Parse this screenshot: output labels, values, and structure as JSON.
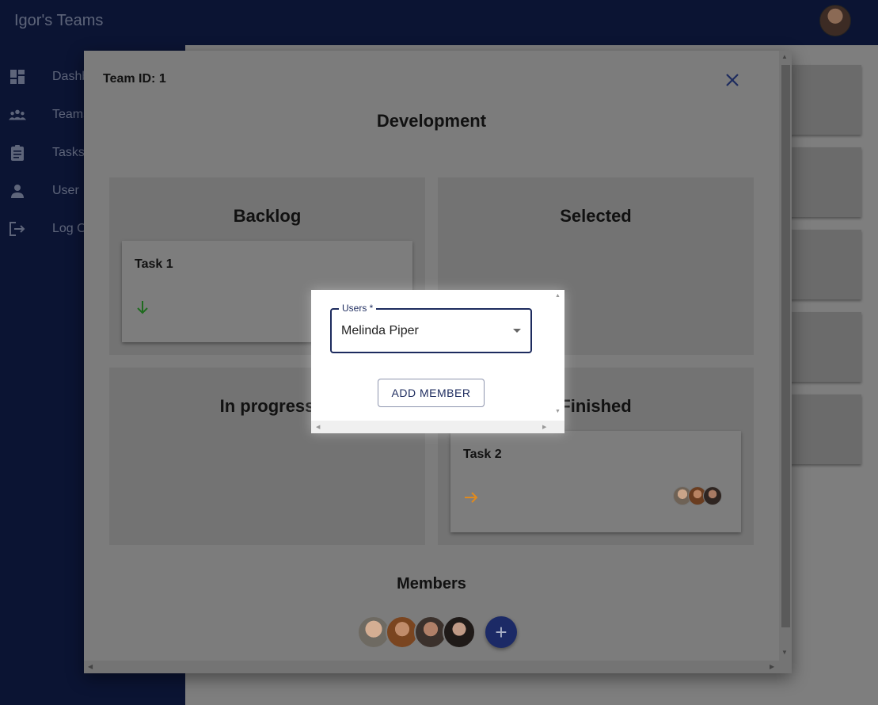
{
  "app": {
    "title": "Igor's Teams"
  },
  "sidebar": {
    "items": [
      {
        "label": "Dashboard",
        "icon": "dashboard-icon"
      },
      {
        "label": "Teams",
        "icon": "people-icon"
      },
      {
        "label": "Tasks",
        "icon": "clipboard-icon"
      },
      {
        "label": "User",
        "icon": "person-icon"
      },
      {
        "label": "Log Out",
        "icon": "logout-icon"
      }
    ]
  },
  "team_modal": {
    "team_id_label": "Team ID: 1",
    "team_name": "Development",
    "columns": [
      {
        "title": "Backlog",
        "tasks": [
          {
            "title": "Task 1",
            "arrow": "down",
            "arrow_color": "#1f6b1f"
          }
        ]
      },
      {
        "title": "Selected",
        "tasks": []
      },
      {
        "title": "In progress",
        "tasks": []
      },
      {
        "title": "Finished",
        "tasks": [
          {
            "title": "Task 2",
            "arrow": "right",
            "arrow_color": "#e08a1e",
            "assignee_count": 3
          }
        ]
      }
    ],
    "members_title": "Members",
    "member_count": 4,
    "add_member_fab": "+"
  },
  "add_user_dialog": {
    "field_label": "Users *",
    "selected_user": "Melinda Piper",
    "button_label": "ADD MEMBER"
  },
  "colors": {
    "primary": "#1d2b5e",
    "appbar": "#0b1433",
    "backdrop": "#7e7e7e"
  }
}
